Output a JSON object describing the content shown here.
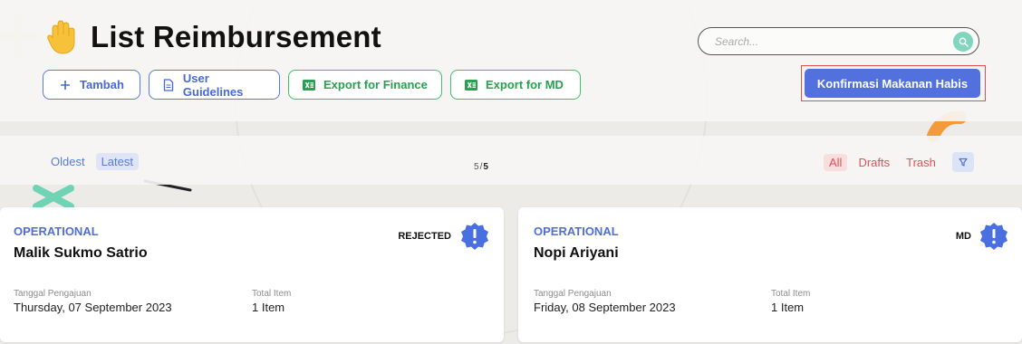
{
  "header": {
    "title": "List Reimbursement",
    "buttons": {
      "add": "Tambah",
      "guidelines": "User Guidelines",
      "export_finance": "Export for Finance",
      "export_md": "Export for MD"
    },
    "search": {
      "placeholder": "Search..."
    },
    "confirm_button": "Konfirmasi Makanan Habis"
  },
  "filterbar": {
    "sort": [
      "Oldest",
      "Latest"
    ],
    "active_sort": "Latest",
    "pager": {
      "current": "5",
      "separator": "/",
      "total": "5"
    },
    "filters": [
      "All",
      "Drafts",
      "Trash"
    ],
    "active_filter": "All"
  },
  "cards": [
    {
      "category": "OPERATIONAL",
      "name": "Malik Sukmo Satrio",
      "status": "REJECTED",
      "date_label": "Tanggal Pengajuan",
      "date": "Thursday, 07 September 2023",
      "items_label": "Total Item",
      "items": "1 Item"
    },
    {
      "category": "OPERATIONAL",
      "name": "Nopi Ariyani",
      "status": "MD",
      "date_label": "Tanggal Pengajuan",
      "date": "Friday, 08 September 2023",
      "items_label": "Total Item",
      "items": "1 Item"
    }
  ],
  "colors": {
    "accent_blue": "#5271df",
    "export_green": "#27a150",
    "filter_red": "#e05252",
    "badge_blue": "#4a6fe0",
    "search_teal": "#7fd6bd"
  },
  "icons": {
    "title": "raised-hand-icon",
    "add": "plus-icon",
    "guidelines": "document-icon",
    "export": "excel-icon",
    "search": "search-icon",
    "filter": "filter-icon",
    "badge": "exclamation-badge-icon"
  }
}
